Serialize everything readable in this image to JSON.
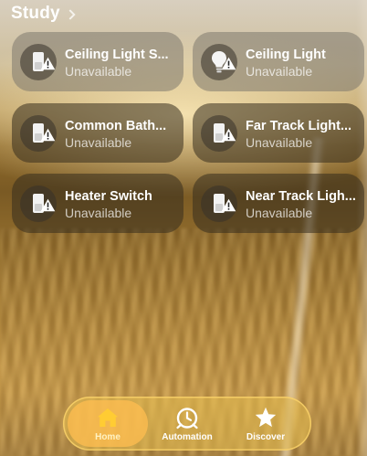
{
  "header": {
    "title": "Study"
  },
  "accessories": [
    {
      "name": "Ceiling Light S...",
      "status": "Unavailable",
      "icon": "switch-icon"
    },
    {
      "name": "Ceiling Light",
      "status": "Unavailable",
      "icon": "lightbulb-icon"
    },
    {
      "name": "Common Bath...",
      "status": "Unavailable",
      "icon": "switch-icon"
    },
    {
      "name": "Far Track Light...",
      "status": "Unavailable",
      "icon": "switch-icon"
    },
    {
      "name": "Heater Switch",
      "status": "Unavailable",
      "icon": "switch-icon"
    },
    {
      "name": "Near Track Ligh...",
      "status": "Unavailable",
      "icon": "switch-icon"
    }
  ],
  "tabbar": {
    "tabs": [
      {
        "label": "Home",
        "icon": "house-icon",
        "active": true
      },
      {
        "label": "Automation",
        "icon": "clock-check-icon",
        "active": false
      },
      {
        "label": "Discover",
        "icon": "star-icon",
        "active": false
      }
    ]
  },
  "colors": {
    "accent": "#ffcc33",
    "warning": "#ffffff"
  }
}
